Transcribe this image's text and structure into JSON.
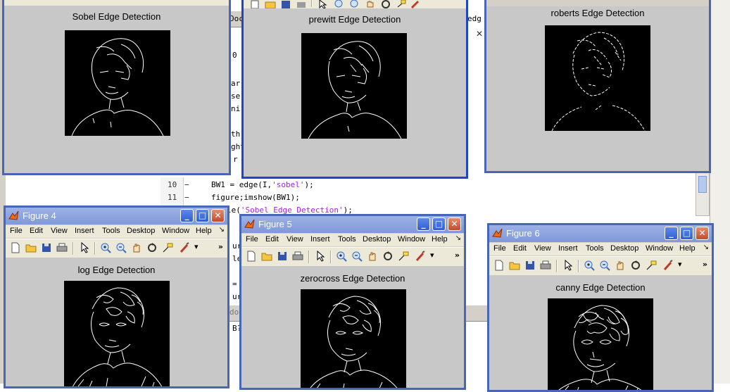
{
  "editor": {
    "line_numbers": [
      "10",
      "11"
    ],
    "code_line_10": "BW1 = edge(I,",
    "code_line_10_str": "'sobel'",
    "code_line_10_end": ");",
    "code_line_11": "figure;imshow(BW1);",
    "code_line_12_tail": "le(",
    "code_line_12_str": "'Sobel Edge Detection'",
    "code_line_12_end": ");",
    "fragments": [
      "ar",
      "se",
      "nir",
      "th",
      "ght",
      "r",
      "ur",
      "le",
      "=",
      "ur",
      "B?"
    ],
    "tab_fragments": [
      "Doc",
      "edg",
      "do",
      "0"
    ]
  },
  "windows": [
    {
      "id": "figure-1",
      "caption": "",
      "plot_title": "Sobel Edge Detection",
      "active": false
    },
    {
      "id": "figure-2",
      "caption": "",
      "plot_title": "prewitt Edge Detection",
      "active": true
    },
    {
      "id": "figure-3",
      "caption": "",
      "plot_title": "roberts Edge Detection",
      "active": false
    },
    {
      "id": "figure-4",
      "caption": "Figure 4",
      "plot_title": "log Edge Detection",
      "active": false,
      "menu": [
        "File",
        "Edit",
        "View",
        "Insert",
        "Tools",
        "Desktop",
        "Window",
        "Help"
      ]
    },
    {
      "id": "figure-5",
      "caption": "Figure 5",
      "plot_title": "zerocross Edge Detection",
      "active": false,
      "menu": [
        "File",
        "Edit",
        "View",
        "Insert",
        "Tools",
        "Desktop",
        "Window",
        "Help"
      ]
    },
    {
      "id": "figure-6",
      "caption": "Figure 6",
      "plot_title": "canny Edge Detection",
      "active": false,
      "menu": [
        "File",
        "Edit",
        "View",
        "Insert",
        "Tools",
        "Desktop",
        "Window",
        "Help"
      ]
    }
  ],
  "toolbar_icons": [
    "new-file-icon",
    "open-folder-icon",
    "save-icon",
    "print-icon",
    "pointer-icon",
    "zoom-in-icon",
    "zoom-out-icon",
    "pan-hand-icon",
    "rotate-3d-icon",
    "data-cursor-icon",
    "brush-icon",
    "dropdown-arrow-icon"
  ],
  "colors": {
    "titlebar_active": "#1d4fc6",
    "titlebar_inactive": "#7f98d9",
    "figure_background": "#c8c8c8",
    "string_literal": "#a020f0"
  },
  "glyphs": {
    "minimize": "_",
    "maximize": "□",
    "close": "✕",
    "menu_more": "↘",
    "toolbar_more": "»"
  }
}
